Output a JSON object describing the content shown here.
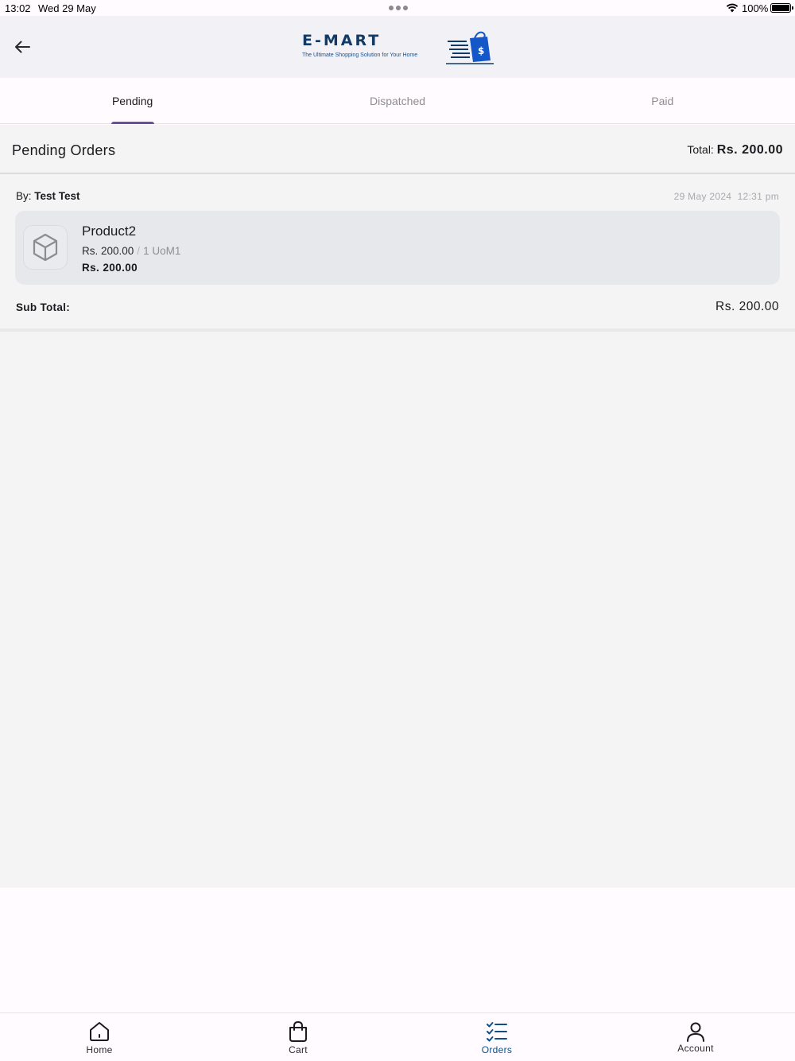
{
  "status_bar": {
    "time": "13:02",
    "date": "Wed 29 May",
    "battery": "100%"
  },
  "header": {
    "brand": "E-MART",
    "tagline": "The Ultimate Shopping Solution for Your Home"
  },
  "tabs": [
    {
      "label": "Pending",
      "active": true
    },
    {
      "label": "Dispatched",
      "active": false
    },
    {
      "label": "Paid",
      "active": false
    }
  ],
  "section": {
    "title": "Pending Orders",
    "total_label": "Total:",
    "total_amount": "Rs. 200.00"
  },
  "order": {
    "by_label": "By:",
    "by_name": "Test Test",
    "date": "29 May 2024",
    "time": "12:31 pm",
    "items": [
      {
        "name": "Product2",
        "unit_price": "Rs. 200.00",
        "separator": "/",
        "uom": "1 UoM1",
        "line_total": "Rs. 200.00"
      }
    ],
    "subtotal_label": "Sub Total:",
    "subtotal_value": "Rs. 200.00"
  },
  "bottom_nav": [
    {
      "label": "Home",
      "icon": "home-icon",
      "active": false
    },
    {
      "label": "Cart",
      "icon": "shopping-bag-icon",
      "active": false
    },
    {
      "label": "Orders",
      "icon": "checklist-icon",
      "active": true
    },
    {
      "label": "Account",
      "icon": "person-icon",
      "active": false
    }
  ],
  "colors": {
    "accent": "#6750a4",
    "brand": "#123a66",
    "active_nav": "#0e4f86"
  }
}
